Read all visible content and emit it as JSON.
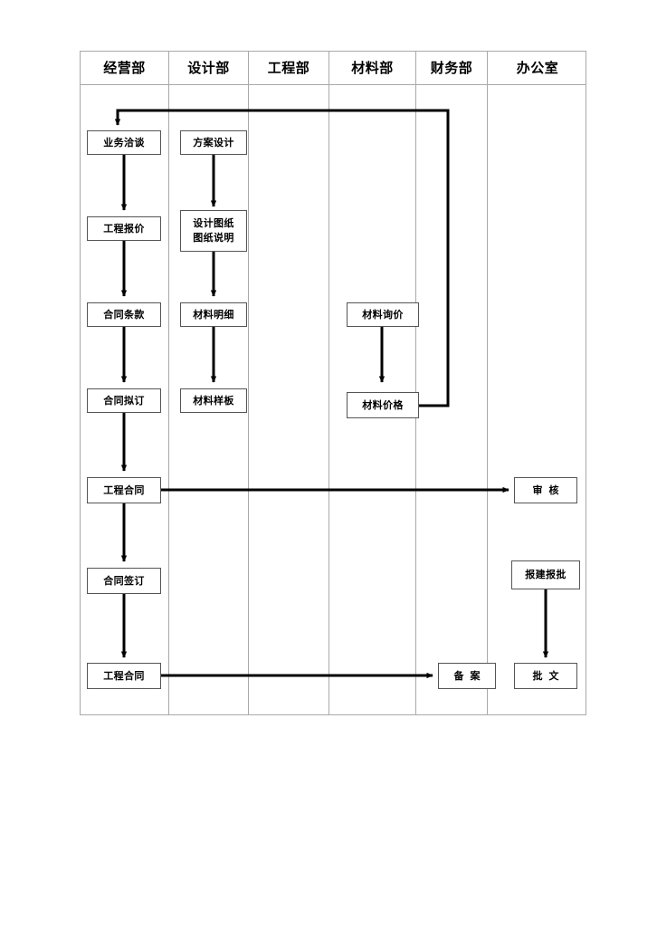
{
  "diagram": {
    "type": "swimlane-flowchart",
    "orientation": "vertical",
    "lanes": [
      {
        "id": "lane-business",
        "label": "经营部"
      },
      {
        "id": "lane-design",
        "label": "设计部"
      },
      {
        "id": "lane-engineering",
        "label": "工程部"
      },
      {
        "id": "lane-material",
        "label": "材料部"
      },
      {
        "id": "lane-finance",
        "label": "财务部"
      },
      {
        "id": "lane-office",
        "label": "办公室"
      }
    ],
    "nodes": [
      {
        "id": "n-ywqt",
        "lane": "lane-business",
        "lines": [
          "业务洽谈"
        ],
        "spaced": false
      },
      {
        "id": "n-gcbj",
        "lane": "lane-business",
        "lines": [
          "工程报价"
        ],
        "spaced": false
      },
      {
        "id": "n-htty",
        "lane": "lane-business",
        "lines": [
          "合同条款"
        ],
        "spaced": false
      },
      {
        "id": "n-htnd",
        "lane": "lane-business",
        "lines": [
          "合同拟订"
        ],
        "spaced": false
      },
      {
        "id": "n-gcht1",
        "lane": "lane-business",
        "lines": [
          "工程合同"
        ],
        "spaced": false
      },
      {
        "id": "n-htqd",
        "lane": "lane-business",
        "lines": [
          "合同签订"
        ],
        "spaced": false
      },
      {
        "id": "n-gcht2",
        "lane": "lane-business",
        "lines": [
          "工程合同"
        ],
        "spaced": false
      },
      {
        "id": "n-fasj",
        "lane": "lane-design",
        "lines": [
          "方案设计"
        ],
        "spaced": false
      },
      {
        "id": "n-sjtz",
        "lane": "lane-design",
        "lines": [
          "设计图纸",
          "图纸说明"
        ],
        "spaced": false
      },
      {
        "id": "n-clmx",
        "lane": "lane-design",
        "lines": [
          "材料明细"
        ],
        "spaced": false
      },
      {
        "id": "n-clyb",
        "lane": "lane-design",
        "lines": [
          "材料样板"
        ],
        "spaced": false
      },
      {
        "id": "n-clxj",
        "lane": "lane-material",
        "lines": [
          "材料询价"
        ],
        "spaced": false
      },
      {
        "id": "n-cljg",
        "lane": "lane-material",
        "lines": [
          "材料价格"
        ],
        "spaced": false
      },
      {
        "id": "n-ba",
        "lane": "lane-finance",
        "lines": [
          "备案"
        ],
        "spaced": true
      },
      {
        "id": "n-sh",
        "lane": "lane-office",
        "lines": [
          "审核"
        ],
        "spaced": true
      },
      {
        "id": "n-bjbp",
        "lane": "lane-office",
        "lines": [
          "报建报批"
        ],
        "spaced": false
      },
      {
        "id": "n-pw",
        "lane": "lane-office",
        "lines": [
          "批文"
        ],
        "spaced": true
      }
    ],
    "edges": [
      {
        "from": "n-ywqt",
        "to": "n-gcbj",
        "kind": "vertical-arrow"
      },
      {
        "from": "n-gcbj",
        "to": "n-htty",
        "kind": "vertical-arrow"
      },
      {
        "from": "n-htty",
        "to": "n-htnd",
        "kind": "vertical-arrow"
      },
      {
        "from": "n-htnd",
        "to": "n-gcht1",
        "kind": "vertical-arrow"
      },
      {
        "from": "n-gcht1",
        "to": "n-htqd",
        "kind": "vertical-arrow"
      },
      {
        "from": "n-htqd",
        "to": "n-gcht2",
        "kind": "vertical-arrow"
      },
      {
        "from": "n-fasj",
        "to": "n-sjtz",
        "kind": "vertical-arrow"
      },
      {
        "from": "n-sjtz",
        "to": "n-clmx",
        "kind": "vertical-arrow"
      },
      {
        "from": "n-clmx",
        "to": "n-clyb",
        "kind": "vertical-arrow"
      },
      {
        "from": "n-clxj",
        "to": "n-cljg",
        "kind": "vertical-arrow"
      },
      {
        "from": "n-cljg",
        "to": "n-ywqt",
        "kind": "feedback-loop"
      },
      {
        "from": "n-gcht1",
        "to": "n-sh",
        "kind": "horizontal-arrow"
      },
      {
        "from": "n-gcht2",
        "to": "n-ba",
        "kind": "horizontal-arrow"
      },
      {
        "from": "n-bjbp",
        "to": "n-pw",
        "kind": "vertical-arrow"
      }
    ],
    "colors": {
      "lane_border": "#a9a9a9",
      "node_border": "#555555",
      "node_fill": "#ffffff",
      "connector": "#000000",
      "text": "#000000",
      "page_background": "#ffffff"
    }
  }
}
